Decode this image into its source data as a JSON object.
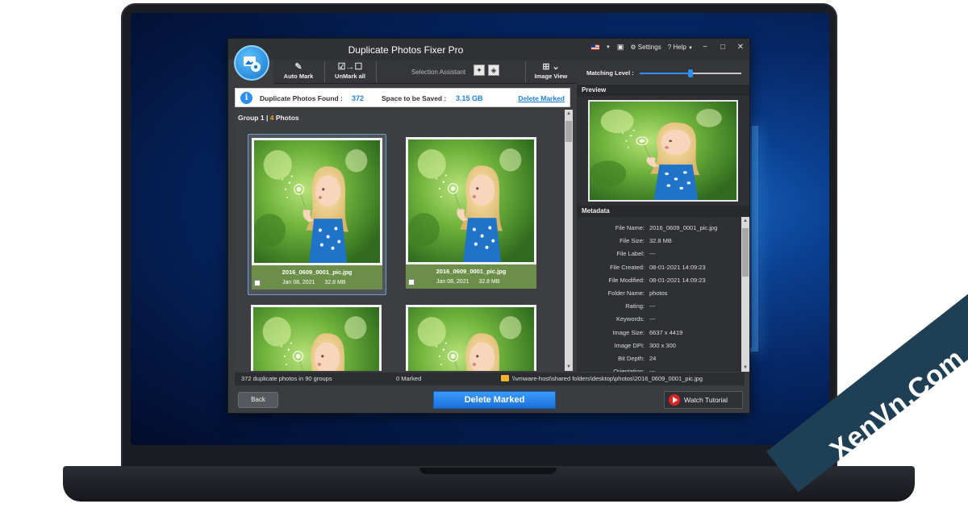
{
  "app": {
    "title": "Duplicate Photos Fixer Pro",
    "settings_label": "Settings",
    "help_label": "? Help"
  },
  "toolbar": {
    "auto_mark": "Auto Mark",
    "unmark_all": "UnMark all",
    "selection_assistant": "Selection Assistant",
    "image_view": "Image View",
    "matching_level": "Matching Level :",
    "matching_level_value": 0.5
  },
  "summary": {
    "found_label": "Duplicate Photos Found :",
    "found_value": "372",
    "space_label": "Space to be Saved :",
    "space_value": "3.15 GB",
    "delete_link": "Delete Marked"
  },
  "group": {
    "label": "Group 1 |",
    "count": "4",
    "photos_word": "Photos"
  },
  "photos": [
    {
      "name": "2016_0609_0001_pic.jpg",
      "date": "Jan 08, 2021",
      "size": "32.8 MB",
      "selected": true
    },
    {
      "name": "2016_0609_0001_pic.jpg",
      "date": "Jan 08, 2021",
      "size": "32.8 MB",
      "selected": false
    },
    {
      "name": "",
      "date": "",
      "size": "",
      "selected": false
    },
    {
      "name": "",
      "date": "",
      "size": "",
      "selected": false
    }
  ],
  "preview": {
    "heading": "Preview"
  },
  "metadata": {
    "heading": "Metadata",
    "rows": [
      {
        "key": "File Name:",
        "value": "2016_0609_0001_pic.jpg"
      },
      {
        "key": "File Size:",
        "value": "32.8 MB"
      },
      {
        "key": "File Label:",
        "value": "---"
      },
      {
        "key": "File Created:",
        "value": "08-01-2021 14:09:23"
      },
      {
        "key": "File Modified:",
        "value": "08-01-2021 14:09:23"
      },
      {
        "key": "Folder Name:",
        "value": "photos"
      },
      {
        "key": "Rating:",
        "value": "---"
      },
      {
        "key": "Keywords:",
        "value": "---"
      },
      {
        "key": "Image Size:",
        "value": "6637 x 4419"
      },
      {
        "key": "Image DPI:",
        "value": "300 x 300"
      },
      {
        "key": "Bit Depth:",
        "value": "24"
      },
      {
        "key": "Orientation:",
        "value": "---"
      }
    ]
  },
  "status": {
    "groups": "372 duplicate photos in 90 groups",
    "marked": "0 Marked",
    "path": "\\\\vmware-host\\shared folders\\desktop\\photos\\2016_0609_0001_pic.jpg"
  },
  "buttons": {
    "back": "Back",
    "delete_marked": "Delete Marked",
    "watch_tutorial": "Watch Tutorial"
  },
  "watermark": "XenVn.Com",
  "colors": {
    "accent": "#2d8ff0",
    "card_info_bg": "#6c8e48",
    "count_highlight": "#f5a623",
    "tutorial_play": "#e02323"
  }
}
